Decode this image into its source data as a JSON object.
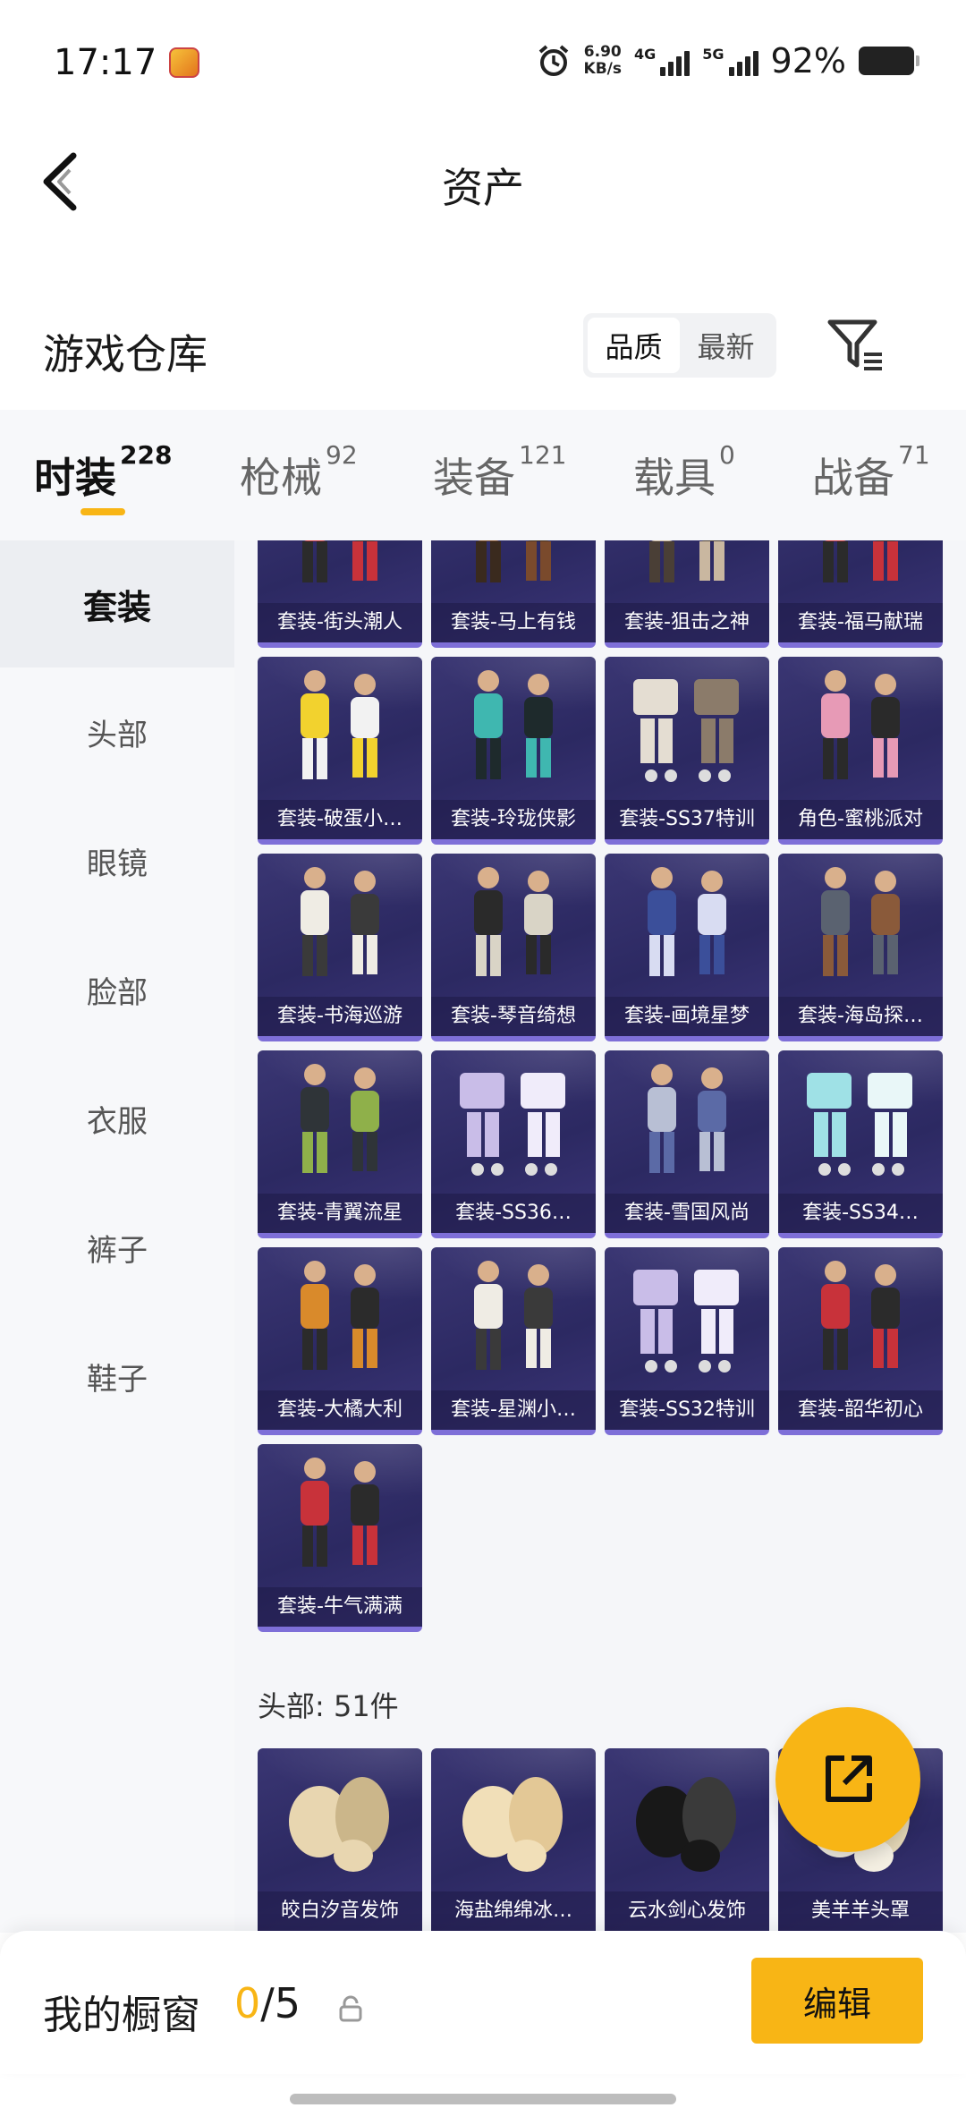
{
  "status_bar": {
    "time": "17:17",
    "net_speed_value": "6.90",
    "net_speed_unit": "KB/s",
    "signal_1": "4G",
    "signal_2": "5G",
    "battery": "92%"
  },
  "header": {
    "title": "资产"
  },
  "warehouse": {
    "title": "游戏仓库",
    "sort_options": [
      "品质",
      "最新"
    ],
    "active_sort": "品质"
  },
  "tabs": [
    {
      "label": "时装",
      "count": "228",
      "active": true
    },
    {
      "label": "枪械",
      "count": "92",
      "active": false
    },
    {
      "label": "装备",
      "count": "121",
      "active": false
    },
    {
      "label": "载具",
      "count": "0",
      "active": false
    },
    {
      "label": "战备",
      "count": "71",
      "active": false
    }
  ],
  "sidebar": {
    "items": [
      "套装",
      "头部",
      "眼镜",
      "脸部",
      "衣服",
      "裤子",
      "鞋子"
    ],
    "active": "套装"
  },
  "suits": [
    {
      "label": "套装-街头潮人",
      "icon": "outfit-pair-red"
    },
    {
      "label": "套装-马上有钱",
      "icon": "outfit-brown"
    },
    {
      "label": "套装-狙击之神",
      "icon": "outfit-beige"
    },
    {
      "label": "套装-福马献瑞",
      "icon": "outfit-pair-red"
    },
    {
      "label": "套装-破蛋小…",
      "icon": "outfit-chick"
    },
    {
      "label": "套装-玲珑侠影",
      "icon": "outfit-pair-teal"
    },
    {
      "label": "套装-SS37特训",
      "icon": "outfit-pieces-beige"
    },
    {
      "label": "角色-蜜桃派对",
      "icon": "character-pink"
    },
    {
      "label": "套装-书海巡游",
      "icon": "outfit-pair-white"
    },
    {
      "label": "套装-琴音绮想",
      "icon": "outfit-pair-black"
    },
    {
      "label": "套装-画境星梦",
      "icon": "outfit-pair-blue"
    },
    {
      "label": "套装-海岛探…",
      "icon": "outfit-jacket-grey"
    },
    {
      "label": "套装-青翼流星",
      "icon": "outfit-pair-dark"
    },
    {
      "label": "套装-SS36…",
      "icon": "outfit-pieces-lilac"
    },
    {
      "label": "套装-雪国风尚",
      "icon": "outfit-pair-silver"
    },
    {
      "label": "套装-SS34…",
      "icon": "outfit-pieces-cyan"
    },
    {
      "label": "套装-大橘大利",
      "icon": "outfit-pair-orange"
    },
    {
      "label": "套装-星渊小…",
      "icon": "outfit-pair-white"
    },
    {
      "label": "套装-SS32特训",
      "icon": "outfit-pieces-lilac"
    },
    {
      "label": "套装-韶华初心",
      "icon": "outfit-pair-red"
    },
    {
      "label": "套装-牛气满满",
      "icon": "outfit-pair-red"
    }
  ],
  "head_section": {
    "title": "头部: 51件",
    "items": [
      {
        "label": "皎白汐音发饰",
        "icon": "hair-blonde"
      },
      {
        "label": "海盐绵绵冰…",
        "icon": "hair-cream"
      },
      {
        "label": "云水剑心发饰",
        "icon": "hair-black"
      },
      {
        "label": "美羊羊头罩",
        "icon": "sheep-hood"
      }
    ]
  },
  "showcase": {
    "title": "我的橱窗",
    "current": "0",
    "total": "/5",
    "edit_label": "编辑"
  },
  "colors": {
    "accent": "#f8b515",
    "card_bg": "#2c2962",
    "card_border": "#7e6fd8"
  }
}
